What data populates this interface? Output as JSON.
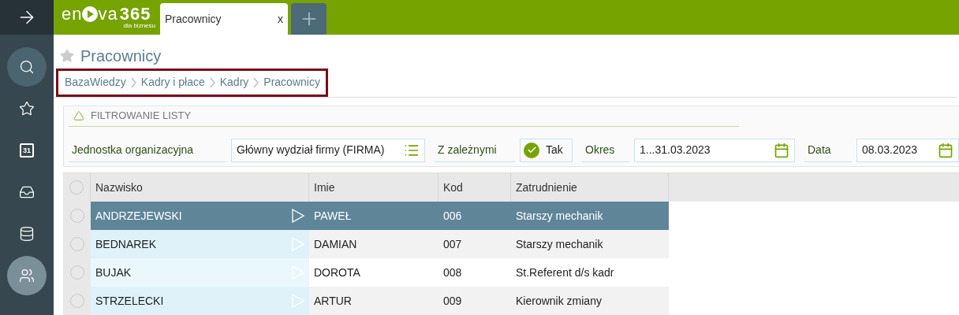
{
  "sidebar": {
    "items": [
      {
        "kind": "search",
        "selected": false
      },
      {
        "kind": "star",
        "selected": false
      },
      {
        "kind": "calendar",
        "day": "31",
        "selected": false
      },
      {
        "kind": "inbox",
        "selected": false
      },
      {
        "kind": "database",
        "selected": false
      },
      {
        "kind": "users",
        "selected": true
      }
    ]
  },
  "logo": {
    "before": "en",
    "after": "va",
    "number": "365",
    "tagline": "dla biznesu"
  },
  "tabs": [
    {
      "label": "Pracownicy",
      "close": "x",
      "selected": true
    }
  ],
  "page": {
    "title": "Pracownicy",
    "favorite": false
  },
  "breadcrumb": [
    "BazaWiedzy",
    "Kadry i płace",
    "Kadry",
    "Pracownicy"
  ],
  "filter": {
    "title": "FILTROWANIE LISTY",
    "expanded": true,
    "fields": [
      {
        "kind": "list",
        "label": "Jednostka organizacyjna",
        "value": "Główny wydział firmy (FIRMA)"
      },
      {
        "kind": "toggle",
        "label": "Z zależnymi",
        "value": "Tak",
        "checked": true
      },
      {
        "kind": "date",
        "label": "Okres",
        "value": "1...31.03.2023"
      },
      {
        "kind": "date",
        "label": "Data",
        "value": "08.03.2023"
      }
    ]
  },
  "table": {
    "all_checked": false,
    "columns": [
      "Nazwisko",
      "Imie",
      "Kod",
      "Zatrudnienie"
    ],
    "rows": [
      {
        "cells": [
          "ANDRZEJEWSKI",
          "PAWEŁ",
          "006",
          "Starszy mechanik"
        ],
        "selected": true,
        "checked": false
      },
      {
        "cells": [
          "BEDNAREK",
          "DAMIAN",
          "007",
          "Starszy mechanik"
        ],
        "selected": false,
        "checked": false
      },
      {
        "cells": [
          "BUJAK",
          "DOROTA",
          "008",
          "St.Referent d/s kadr"
        ],
        "selected": false,
        "checked": false
      },
      {
        "cells": [
          "STRZELECKI",
          "ARTUR",
          "009",
          "Kierownik zmiany"
        ],
        "selected": false,
        "checked": false
      }
    ]
  }
}
